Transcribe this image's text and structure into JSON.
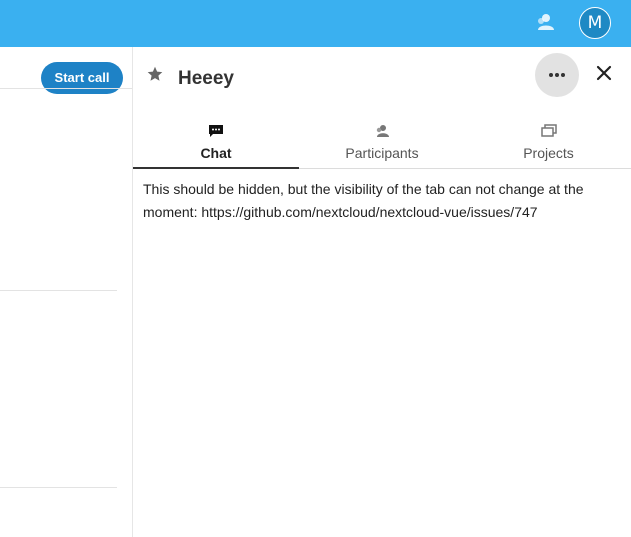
{
  "header": {
    "contacts_icon": "contacts-icon",
    "avatar_initial": "M",
    "bar_color": "#3ab0f0"
  },
  "left": {
    "start_call_label": "Start call",
    "button_color": "#1e82c6"
  },
  "sidebar": {
    "title": "Heeey",
    "star_icon": "star-icon",
    "more_icon": "more-horizontal-icon",
    "close_icon": "close-icon",
    "tabs": [
      {
        "label": "Chat",
        "icon": "chat-icon",
        "active": true
      },
      {
        "label": "Participants",
        "icon": "participants-icon",
        "active": false
      },
      {
        "label": "Projects",
        "icon": "projects-icon",
        "active": false
      }
    ],
    "notice_text": "This should be hidden, but the visibility of the tab can not change at the moment: https://github.com/nextcloud/nextcloud-vue/issues/747"
  }
}
